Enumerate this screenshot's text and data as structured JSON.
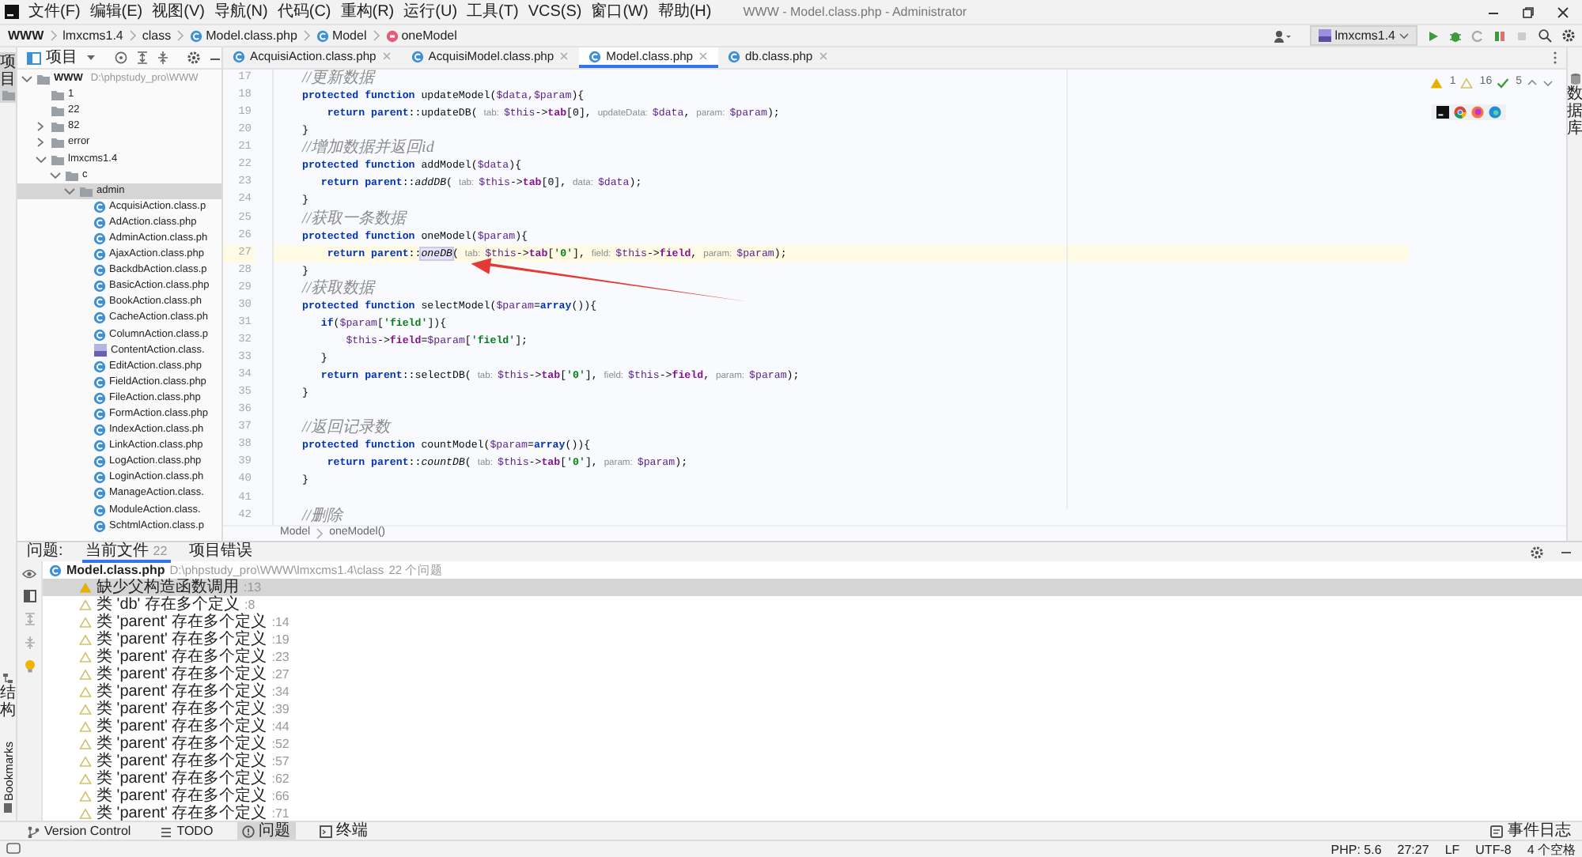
{
  "window": {
    "title": "WWW - Model.class.php - Administrator"
  },
  "menu": [
    "文件(F)",
    "编辑(E)",
    "视图(V)",
    "导航(N)",
    "代码(C)",
    "重构(R)",
    "运行(U)",
    "工具(T)",
    "VCS(S)",
    "窗口(W)",
    "帮助(H)"
  ],
  "breadcrumb": [
    {
      "label": "WWW",
      "kind": "project"
    },
    {
      "label": "lmxcms1.4",
      "kind": "folder"
    },
    {
      "label": "class",
      "kind": "folder"
    },
    {
      "label": "Model.class.php",
      "kind": "class"
    },
    {
      "label": "Model",
      "kind": "class"
    },
    {
      "label": "oneModel",
      "kind": "method"
    }
  ],
  "run_config": "lmxcms1.4",
  "side_left": {
    "top": "项目",
    "bottom": "结构",
    "bookmarks": "Bookmarks"
  },
  "side_right": "数据库",
  "project_panel": {
    "title": "项目"
  },
  "tree": [
    {
      "label": "WWW",
      "path": "D:\\phpstudy_pro\\WWW",
      "kind": "folder",
      "expanded": true,
      "selected": false,
      "children": [
        {
          "label": "1",
          "kind": "folder",
          "selected": false
        },
        {
          "label": "22",
          "kind": "folder",
          "selected": false
        },
        {
          "label": "82",
          "kind": "folder",
          "expanded": false,
          "selected": false
        },
        {
          "label": "error",
          "kind": "folder",
          "expanded": false,
          "selected": false
        },
        {
          "label": "lmxcms1.4",
          "kind": "folder",
          "expanded": true,
          "selected": false,
          "children": [
            {
              "label": "c",
              "kind": "folder",
              "expanded": true,
              "selected": false,
              "children": [
                {
                  "label": "admin",
                  "kind": "folder",
                  "expanded": true,
                  "selected": true,
                  "children": [
                    {
                      "label": "AcquisiAction.class.p",
                      "kind": "class",
                      "selected": false
                    },
                    {
                      "label": "AdAction.class.php",
                      "kind": "class",
                      "selected": false
                    },
                    {
                      "label": "AdminAction.class.ph",
                      "kind": "class",
                      "selected": false
                    },
                    {
                      "label": "AjaxAction.class.php",
                      "kind": "class",
                      "selected": false
                    },
                    {
                      "label": "BackdbAction.class.p",
                      "kind": "class",
                      "selected": false
                    },
                    {
                      "label": "BasicAction.class.php",
                      "kind": "class",
                      "selected": false
                    },
                    {
                      "label": "BookAction.class.ph",
                      "kind": "class",
                      "selected": false
                    },
                    {
                      "label": "CacheAction.class.ph",
                      "kind": "class",
                      "selected": false
                    },
                    {
                      "label": "ColumnAction.class.p",
                      "kind": "class",
                      "selected": false
                    },
                    {
                      "label": "ContentAction.class.",
                      "kind": "php",
                      "selected": false
                    },
                    {
                      "label": "EditAction.class.php",
                      "kind": "class",
                      "selected": false
                    },
                    {
                      "label": "FieldAction.class.php",
                      "kind": "class",
                      "selected": false
                    },
                    {
                      "label": "FileAction.class.php",
                      "kind": "class",
                      "selected": false
                    },
                    {
                      "label": "FormAction.class.php",
                      "kind": "class",
                      "selected": false
                    },
                    {
                      "label": "IndexAction.class.ph",
                      "kind": "class",
                      "selected": false
                    },
                    {
                      "label": "LinkAction.class.php",
                      "kind": "class",
                      "selected": false
                    },
                    {
                      "label": "LogAction.class.php",
                      "kind": "class",
                      "selected": false
                    },
                    {
                      "label": "LoginAction.class.ph",
                      "kind": "class",
                      "selected": false
                    },
                    {
                      "label": "ManageAction.class.",
                      "kind": "class",
                      "selected": false
                    },
                    {
                      "label": "ModuleAction.class.",
                      "kind": "class",
                      "selected": false
                    },
                    {
                      "label": "SchtmlAction.class.p",
                      "kind": "class",
                      "selected": false
                    }
                  ]
                }
              ]
            }
          ]
        }
      ]
    }
  ],
  "tabs": [
    {
      "label": "AcquisiAction.class.php",
      "selected": false
    },
    {
      "label": "AcquisiModel.class.php",
      "selected": false
    },
    {
      "label": "Model.class.php",
      "selected": true
    },
    {
      "label": "db.class.php",
      "selected": false
    }
  ],
  "inspections": {
    "warnings": "1",
    "weak_warnings": "16",
    "checks": "5"
  },
  "code": [
    {
      "number": "17",
      "current": false,
      "tokens": [
        {
          "kind": "comment",
          "text": "//更新数据"
        }
      ]
    },
    {
      "number": "18",
      "current": false,
      "tokens": [
        {
          "kind": "keyword",
          "text": "protected "
        },
        {
          "kind": "keyword",
          "text": "function"
        },
        {
          "kind": "plain",
          "text": " updateModel("
        },
        {
          "kind": "var",
          "text": "$data,"
        },
        {
          "kind": "var",
          "text": "$param"
        },
        {
          "kind": "plain",
          "text": "){"
        }
      ]
    },
    {
      "number": "19",
      "current": false,
      "tokens": [
        {
          "kind": "keyword",
          "text": "    return "
        },
        {
          "kind": "keyword",
          "text": "parent"
        },
        {
          "kind": "plain",
          "text": "::updateDB( "
        },
        {
          "kind": "hint",
          "text": "tab:"
        },
        {
          "kind": "var",
          "text": "$this"
        },
        {
          "kind": "plain",
          "text": "->"
        },
        {
          "kind": "prop",
          "text": "tab"
        },
        {
          "kind": "plain",
          "text": "[0], "
        },
        {
          "kind": "hint",
          "text": "updateData:"
        },
        {
          "kind": "var",
          "text": "$data"
        },
        {
          "kind": "plain",
          "text": ", "
        },
        {
          "kind": "hint",
          "text": "param:"
        },
        {
          "kind": "var",
          "text": "$param"
        },
        {
          "kind": "plain",
          "text": ");"
        }
      ]
    },
    {
      "number": "20",
      "current": false,
      "tokens": [
        {
          "kind": "plain",
          "text": "}"
        }
      ]
    },
    {
      "number": "21",
      "current": false,
      "tokens": [
        {
          "kind": "comment",
          "text": "//增加数据并返回id"
        }
      ]
    },
    {
      "number": "22",
      "current": false,
      "tokens": [
        {
          "kind": "keyword",
          "text": "protected "
        },
        {
          "kind": "keyword",
          "text": "function"
        },
        {
          "kind": "plain",
          "text": " addModel("
        },
        {
          "kind": "var",
          "text": "$data"
        },
        {
          "kind": "plain",
          "text": "){"
        }
      ]
    },
    {
      "number": "23",
      "current": false,
      "tokens": [
        {
          "kind": "keyword",
          "text": "   return "
        },
        {
          "kind": "keyword",
          "text": "parent"
        },
        {
          "kind": "plain",
          "text": "::"
        },
        {
          "kind": "static",
          "text": "addDB"
        },
        {
          "kind": "plain",
          "text": "( "
        },
        {
          "kind": "hint",
          "text": "tab:"
        },
        {
          "kind": "var",
          "text": "$this"
        },
        {
          "kind": "plain",
          "text": "->"
        },
        {
          "kind": "prop",
          "text": "tab"
        },
        {
          "kind": "plain",
          "text": "[0], "
        },
        {
          "kind": "hint",
          "text": "data:"
        },
        {
          "kind": "var",
          "text": "$data"
        },
        {
          "kind": "plain",
          "text": ");"
        }
      ]
    },
    {
      "number": "24",
      "current": false,
      "tokens": [
        {
          "kind": "plain",
          "text": "}"
        }
      ]
    },
    {
      "number": "25",
      "current": false,
      "tokens": [
        {
          "kind": "comment",
          "text": "//获取一条数据"
        }
      ]
    },
    {
      "number": "26",
      "current": false,
      "tokens": [
        {
          "kind": "keyword",
          "text": "protected "
        },
        {
          "kind": "keyword",
          "text": "function"
        },
        {
          "kind": "plain",
          "text": " oneModel("
        },
        {
          "kind": "var",
          "text": "$param"
        },
        {
          "kind": "plain",
          "text": "){"
        }
      ]
    },
    {
      "number": "27",
      "current": true,
      "tokens": [
        {
          "kind": "keyword",
          "text": "    return "
        },
        {
          "kind": "keyword",
          "text": "parent"
        },
        {
          "kind": "plain",
          "text": "::"
        },
        {
          "kind": "usage",
          "text": "oneDB"
        },
        {
          "kind": "plain",
          "text": "( "
        },
        {
          "kind": "hint",
          "text": "tab:"
        },
        {
          "kind": "var",
          "text": "$this"
        },
        {
          "kind": "plain",
          "text": "->"
        },
        {
          "kind": "prop",
          "text": "tab"
        },
        {
          "kind": "plain",
          "text": "["
        },
        {
          "kind": "string",
          "text": "'0'"
        },
        {
          "kind": "plain",
          "text": "], "
        },
        {
          "kind": "hint",
          "text": "field:"
        },
        {
          "kind": "var",
          "text": "$this"
        },
        {
          "kind": "plain",
          "text": "->"
        },
        {
          "kind": "prop",
          "text": "field"
        },
        {
          "kind": "plain",
          "text": ", "
        },
        {
          "kind": "hint",
          "text": "param:"
        },
        {
          "kind": "var",
          "text": "$param"
        },
        {
          "kind": "plain",
          "text": ");"
        }
      ]
    },
    {
      "number": "28",
      "current": false,
      "tokens": [
        {
          "kind": "plain",
          "text": "}"
        }
      ]
    },
    {
      "number": "29",
      "current": false,
      "tokens": [
        {
          "kind": "comment",
          "text": "//获取数据"
        }
      ]
    },
    {
      "number": "30",
      "current": false,
      "tokens": [
        {
          "kind": "keyword",
          "text": "protected "
        },
        {
          "kind": "keyword",
          "text": "function"
        },
        {
          "kind": "plain",
          "text": " selectModel("
        },
        {
          "kind": "var",
          "text": "$param"
        },
        {
          "kind": "plain",
          "text": "="
        },
        {
          "kind": "keyword",
          "text": "array"
        },
        {
          "kind": "plain",
          "text": "()){"
        }
      ]
    },
    {
      "number": "31",
      "current": false,
      "tokens": [
        {
          "kind": "keyword",
          "text": "   if"
        },
        {
          "kind": "plain",
          "text": "("
        },
        {
          "kind": "var",
          "text": "$param"
        },
        {
          "kind": "plain",
          "text": "["
        },
        {
          "kind": "string",
          "text": "'field'"
        },
        {
          "kind": "plain",
          "text": "]){"
        }
      ]
    },
    {
      "number": "32",
      "current": false,
      "tokens": [
        {
          "kind": "var",
          "text": "       $this"
        },
        {
          "kind": "plain",
          "text": "->"
        },
        {
          "kind": "prop",
          "text": "field"
        },
        {
          "kind": "plain",
          "text": "="
        },
        {
          "kind": "var",
          "text": "$param"
        },
        {
          "kind": "plain",
          "text": "["
        },
        {
          "kind": "string",
          "text": "'field'"
        },
        {
          "kind": "plain",
          "text": "];"
        }
      ]
    },
    {
      "number": "33",
      "current": false,
      "tokens": [
        {
          "kind": "plain",
          "text": "   }"
        }
      ]
    },
    {
      "number": "34",
      "current": false,
      "tokens": [
        {
          "kind": "keyword",
          "text": "   return "
        },
        {
          "kind": "keyword",
          "text": "parent"
        },
        {
          "kind": "plain",
          "text": "::selectDB( "
        },
        {
          "kind": "hint",
          "text": "tab:"
        },
        {
          "kind": "var",
          "text": "$this"
        },
        {
          "kind": "plain",
          "text": "->"
        },
        {
          "kind": "prop",
          "text": "tab"
        },
        {
          "kind": "plain",
          "text": "["
        },
        {
          "kind": "string",
          "text": "'0'"
        },
        {
          "kind": "plain",
          "text": "], "
        },
        {
          "kind": "hint",
          "text": "field:"
        },
        {
          "kind": "var",
          "text": "$this"
        },
        {
          "kind": "plain",
          "text": "->"
        },
        {
          "kind": "prop",
          "text": "field"
        },
        {
          "kind": "plain",
          "text": ", "
        },
        {
          "kind": "hint",
          "text": "param:"
        },
        {
          "kind": "var",
          "text": "$param"
        },
        {
          "kind": "plain",
          "text": ");"
        }
      ]
    },
    {
      "number": "35",
      "current": false,
      "tokens": [
        {
          "kind": "plain",
          "text": "}"
        }
      ]
    },
    {
      "number": "36",
      "current": false
    },
    {
      "number": "37",
      "current": false,
      "tokens": [
        {
          "kind": "comment",
          "text": "//返回记录数"
        }
      ]
    },
    {
      "number": "38",
      "current": false,
      "tokens": [
        {
          "kind": "keyword",
          "text": "protected "
        },
        {
          "kind": "keyword",
          "text": "function"
        },
        {
          "kind": "plain",
          "text": " countModel("
        },
        {
          "kind": "var",
          "text": "$param"
        },
        {
          "kind": "plain",
          "text": "="
        },
        {
          "kind": "keyword",
          "text": "array"
        },
        {
          "kind": "plain",
          "text": "()){"
        }
      ]
    },
    {
      "number": "39",
      "current": false,
      "tokens": [
        {
          "kind": "keyword",
          "text": "    return "
        },
        {
          "kind": "keyword",
          "text": "parent"
        },
        {
          "kind": "plain",
          "text": "::"
        },
        {
          "kind": "static",
          "text": "countDB"
        },
        {
          "kind": "plain",
          "text": "( "
        },
        {
          "kind": "hint",
          "text": "tab:"
        },
        {
          "kind": "var",
          "text": "$this"
        },
        {
          "kind": "plain",
          "text": "->"
        },
        {
          "kind": "prop",
          "text": "tab"
        },
        {
          "kind": "plain",
          "text": "["
        },
        {
          "kind": "string",
          "text": "'0'"
        },
        {
          "kind": "plain",
          "text": "], "
        },
        {
          "kind": "hint",
          "text": "param:"
        },
        {
          "kind": "var",
          "text": "$param"
        },
        {
          "kind": "plain",
          "text": ");"
        }
      ]
    },
    {
      "number": "40",
      "current": false,
      "tokens": [
        {
          "kind": "plain",
          "text": "}"
        }
      ]
    },
    {
      "number": "41",
      "current": false
    },
    {
      "number": "42",
      "current": false,
      "tokens": [
        {
          "kind": "comment",
          "text": "//删除"
        }
      ]
    }
  ],
  "editor_breadcrumb": [
    "Model",
    "oneModel()"
  ],
  "problems": {
    "label": "问题:",
    "tabs": [
      {
        "label": "当前文件",
        "count": "22",
        "selected": true
      },
      {
        "label": "项目错误",
        "selected": false
      }
    ],
    "file": {
      "name": "Model.class.php",
      "path": "D:\\phpstudy_pro\\WWW\\lmxcms1.4\\class",
      "count": "22 个问题"
    },
    "items": [
      {
        "text": "缺少父构造函数调用",
        "line": ":13",
        "kind": "warning",
        "selected": true
      },
      {
        "text": "类 'db' 存在多个定义",
        "line": ":8",
        "kind": "weak",
        "selected": false
      },
      {
        "text": "类 'parent' 存在多个定义",
        "line": ":14",
        "kind": "weak",
        "selected": false
      },
      {
        "text": "类 'parent' 存在多个定义",
        "line": ":19",
        "kind": "weak",
        "selected": false
      },
      {
        "text": "类 'parent' 存在多个定义",
        "line": ":23",
        "kind": "weak",
        "selected": false
      },
      {
        "text": "类 'parent' 存在多个定义",
        "line": ":27",
        "kind": "weak",
        "selected": false
      },
      {
        "text": "类 'parent' 存在多个定义",
        "line": ":34",
        "kind": "weak",
        "selected": false
      },
      {
        "text": "类 'parent' 存在多个定义",
        "line": ":39",
        "kind": "weak",
        "selected": false
      },
      {
        "text": "类 'parent' 存在多个定义",
        "line": ":44",
        "kind": "weak",
        "selected": false
      },
      {
        "text": "类 'parent' 存在多个定义",
        "line": ":52",
        "kind": "weak",
        "selected": false
      },
      {
        "text": "类 'parent' 存在多个定义",
        "line": ":57",
        "kind": "weak",
        "selected": false
      },
      {
        "text": "类 'parent' 存在多个定义",
        "line": ":62",
        "kind": "weak",
        "selected": false
      },
      {
        "text": "类 'parent' 存在多个定义",
        "line": ":66",
        "kind": "weak",
        "selected": false
      },
      {
        "text": "类 'parent' 存在多个定义",
        "line": ":71",
        "kind": "weak",
        "selected": false
      }
    ]
  },
  "tool_windows": [
    {
      "label": "Version Control",
      "kind": "vcs",
      "selected": false
    },
    {
      "label": "TODO",
      "kind": "todo",
      "selected": false
    },
    {
      "label": "问题",
      "kind": "problems",
      "selected": true
    },
    {
      "label": "终端",
      "kind": "terminal",
      "selected": false
    }
  ],
  "event_log": "事件日志",
  "status_bar": [
    "PHP: 5.6",
    "27:27",
    "LF",
    "UTF-8",
    "4 个空格"
  ]
}
